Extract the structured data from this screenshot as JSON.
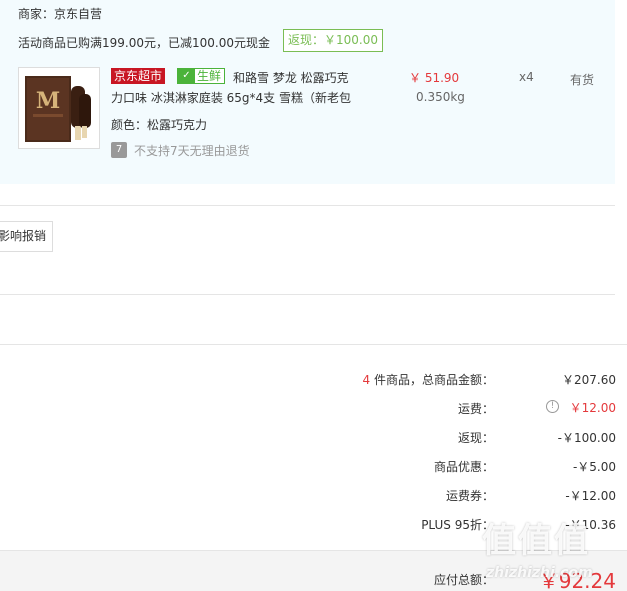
{
  "order": {
    "seller": "商家：京东自营",
    "promo_text": "活动商品已购满199.00元，已减100.00元现金",
    "rebate_badge": "返现：￥100.00"
  },
  "product": {
    "tag_supermarket": "京东超市",
    "tag_fresh": "生鲜",
    "fresh_icon": "fresh-icon",
    "name_line1": "和路雪 梦龙 松露巧克",
    "name_line2": "力口味 冰淇淋家庭装 65g*4支 雪糕（新老包",
    "color": "颜色：松露巧克力",
    "return_icon": "7",
    "return_policy": "不支持7天无理由退货",
    "unit_price": "￥ 51.90",
    "weight": "0.350kg",
    "quantity": "x4",
    "stock": "有货",
    "thumbnail_icon": "ice-cream-box-image",
    "thumbnail_brand": "M"
  },
  "reimburse_button": "影响报销",
  "summary": {
    "count": "4",
    "count_suffix": "件商品，总商品金额：",
    "goods_total": "￥207.60",
    "freight_label": "运费：",
    "freight_value": "￥12.00",
    "freight_info_icon": "info-icon",
    "rebate_label": "返现：",
    "rebate_value": "-￥100.00",
    "discount_label": "商品优惠：",
    "discount_value": "-￥5.00",
    "freight_coupon_label": "运费券：",
    "freight_coupon_value": "-￥12.00",
    "plus_label": "PLUS 95折：",
    "plus_value": "-￥10.36"
  },
  "total": {
    "label": "应付总额：",
    "value": "￥92.24"
  },
  "watermark": {
    "glyphs": "值值值",
    "site": "zhizhizhi.com"
  },
  "colors": {
    "accent_red": "#e4393c",
    "supermarket_red": "#c81623",
    "fresh_green": "#4bb33a",
    "rebate_green": "#7abd54",
    "panel_bg": "#f3fbfe"
  }
}
